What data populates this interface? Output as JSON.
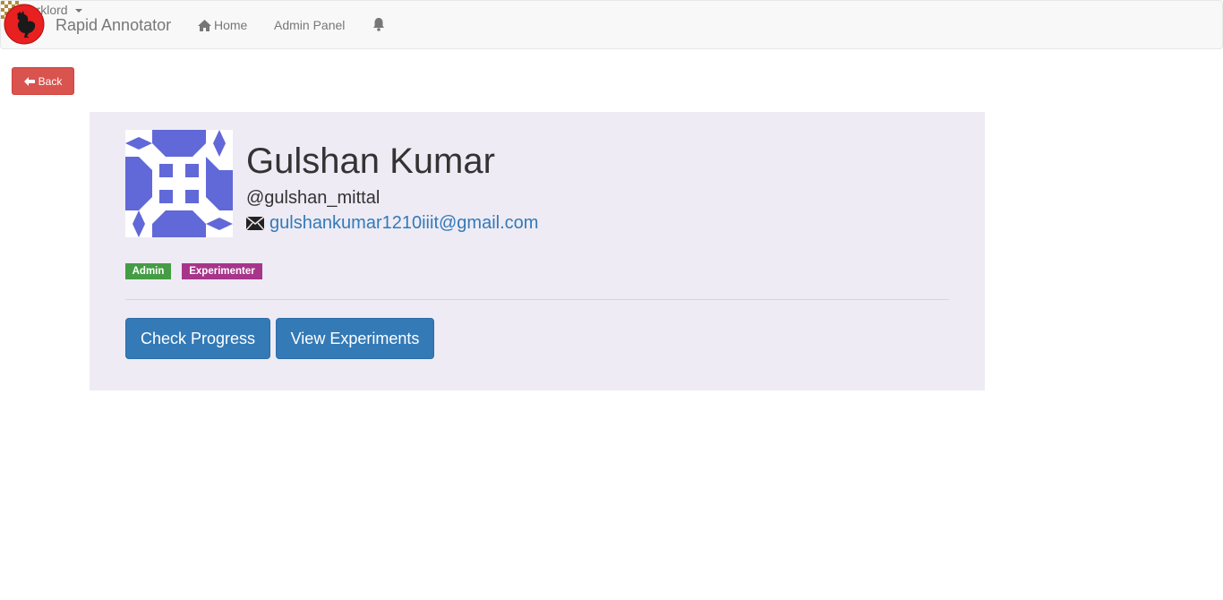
{
  "navbar": {
    "brand": "Rapid Annotator",
    "home_label": "Home",
    "admin_label": "Admin Panel",
    "user_label": "darklord"
  },
  "back_button": {
    "label": "Back"
  },
  "profile": {
    "name": "Gulshan Kumar",
    "handle": "@gulshan_mittal",
    "email": "gulshankumar1210iiit@gmail.com",
    "badges": [
      "Admin",
      "Experimenter"
    ]
  },
  "actions": {
    "check_progress": "Check Progress",
    "view_experiments": "View Experiments"
  },
  "colors": {
    "danger": "#d9534f",
    "primary": "#337ab7",
    "badge_admin": "#449d44",
    "badge_experimenter": "#a7358a",
    "card_bg": "#eeebf5",
    "identicon": "#6168d8"
  }
}
